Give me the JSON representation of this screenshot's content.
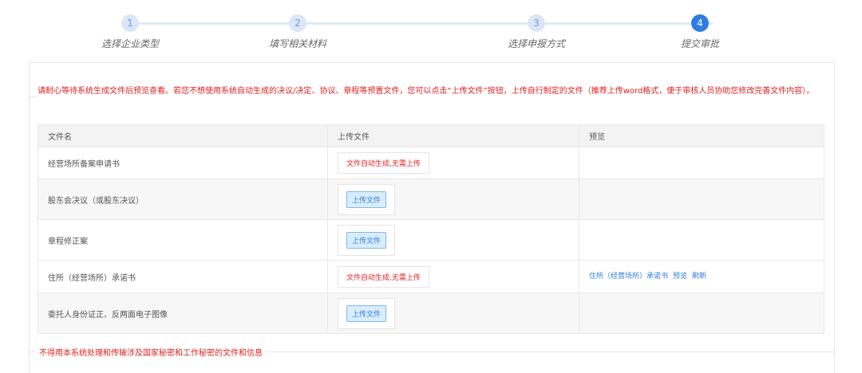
{
  "steps": [
    {
      "number": "1",
      "label": "选择企业类型"
    },
    {
      "number": "2",
      "label": "填写相关材料"
    },
    {
      "number": "3",
      "label": "选择申报方式"
    },
    {
      "number": "4",
      "label": "提交审批"
    }
  ],
  "notice": "请耐心等待系统生成文件后预览查看。若您不想使用系统自动生成的决议/决定、协议、章程等预置文件，您可以点击“上传文件”按钮，上传自行制定的文件（推荐上传word格式，便于审核人员协助您修改完善文件内容）。",
  "table": {
    "headers": [
      "文件名",
      "上传文件",
      "预览"
    ],
    "rows": [
      {
        "name": "经营场所备案申请书",
        "upload": "文件自动生成,无需上传"
      },
      {
        "name": "股东会决议（或股东决议）",
        "upload": "上传文件"
      },
      {
        "name": "章程修正案",
        "upload": "上传文件"
      },
      {
        "name": "住所（经营场所）承诺书",
        "upload": "文件自动生成,无需上传",
        "preview_name": "住所（经营场所）承诺书",
        "preview_label": "预览",
        "refresh_label": "刷新"
      },
      {
        "name": "委托人身份证正、反两面电子图像",
        "upload": "上传文件"
      }
    ]
  },
  "footer_note": "不得用本系统处理和传输涉及国家秘密和工作秘密的文件和信息",
  "colors": {
    "accent": "#2f7de1",
    "warning": "#e02020"
  }
}
